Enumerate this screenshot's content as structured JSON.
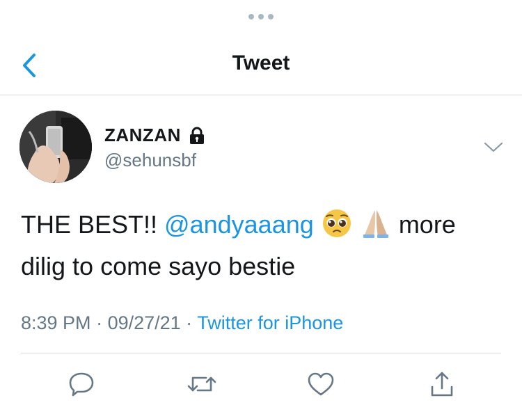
{
  "header": {
    "title": "Tweet"
  },
  "user": {
    "display_name": "ZANZAN",
    "handle": "@sehunsbf",
    "protected": true
  },
  "tweet": {
    "text_before": "THE BEST!! ",
    "mention": "@andyaaang",
    "text_after_emojis": " more",
    "line2": "dilig to come sayo bestie",
    "emojis": [
      "pleading-face-emoji",
      "folded-hands-emoji"
    ]
  },
  "meta": {
    "time": "8:39 PM",
    "sep1": " · ",
    "date": "09/27/21",
    "sep2": " · ",
    "source": "Twitter for iPhone"
  },
  "actions": [
    "reply-icon",
    "retweet-icon",
    "like-icon",
    "share-icon"
  ],
  "colors": {
    "accent": "#1b95e0",
    "secondary_text": "#657786",
    "primary_text": "#14171a",
    "divider": "#d6dadd"
  }
}
